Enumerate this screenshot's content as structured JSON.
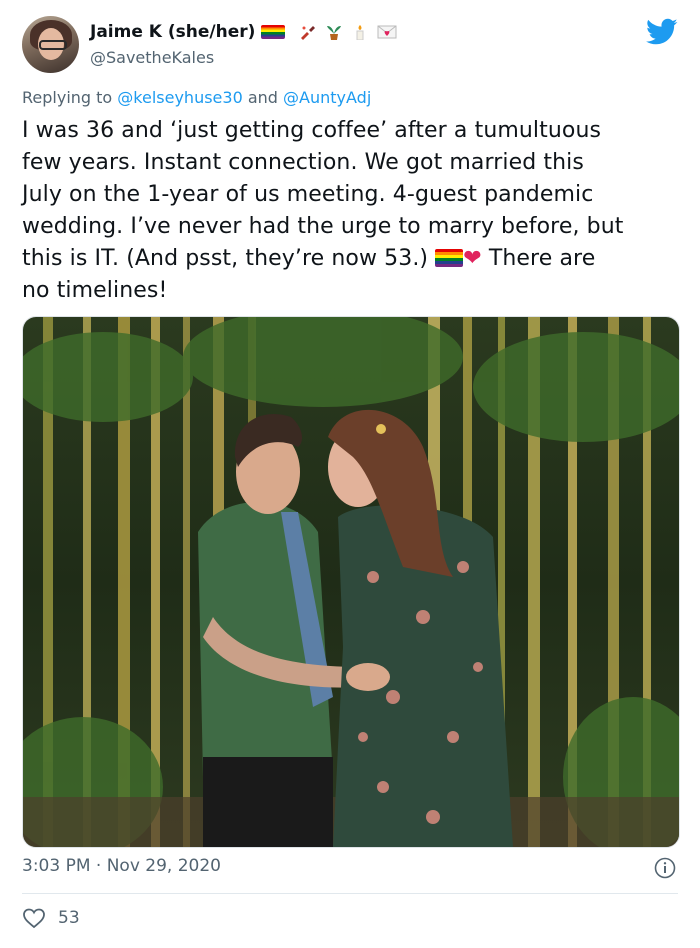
{
  "author": {
    "display_name": "Jaime K (she/her)",
    "handle": "@SavetheKales",
    "emoji_icons": [
      "rainbow-flag-icon",
      "nail-polish-icon",
      "potted-plant-icon",
      "candle-icon",
      "love-letter-icon"
    ]
  },
  "reply": {
    "prefix": "Replying to",
    "mention1": "@kelseyhuse30",
    "connector": "and",
    "mention2": "@AuntyAdj"
  },
  "text": {
    "line1": "I was 36 and ‘just getting coffee’ after a tumultuous",
    "line2": "few years. Instant connection. We got married this",
    "line3": "July on the 1-year of us meeting. 4-guest pandemic",
    "line4": "wedding. I’ve never had the urge to marry before, but",
    "line5a": "this is IT. (And psst, they’re now 53.)",
    "line5b": "There are",
    "line6": "no timelines!"
  },
  "timestamp": "3:03 PM · Nov 29, 2020",
  "likes": "53",
  "colors": {
    "brand": "#1d9bf0",
    "heart": "#e0245e",
    "secondary_text": "#536471"
  }
}
